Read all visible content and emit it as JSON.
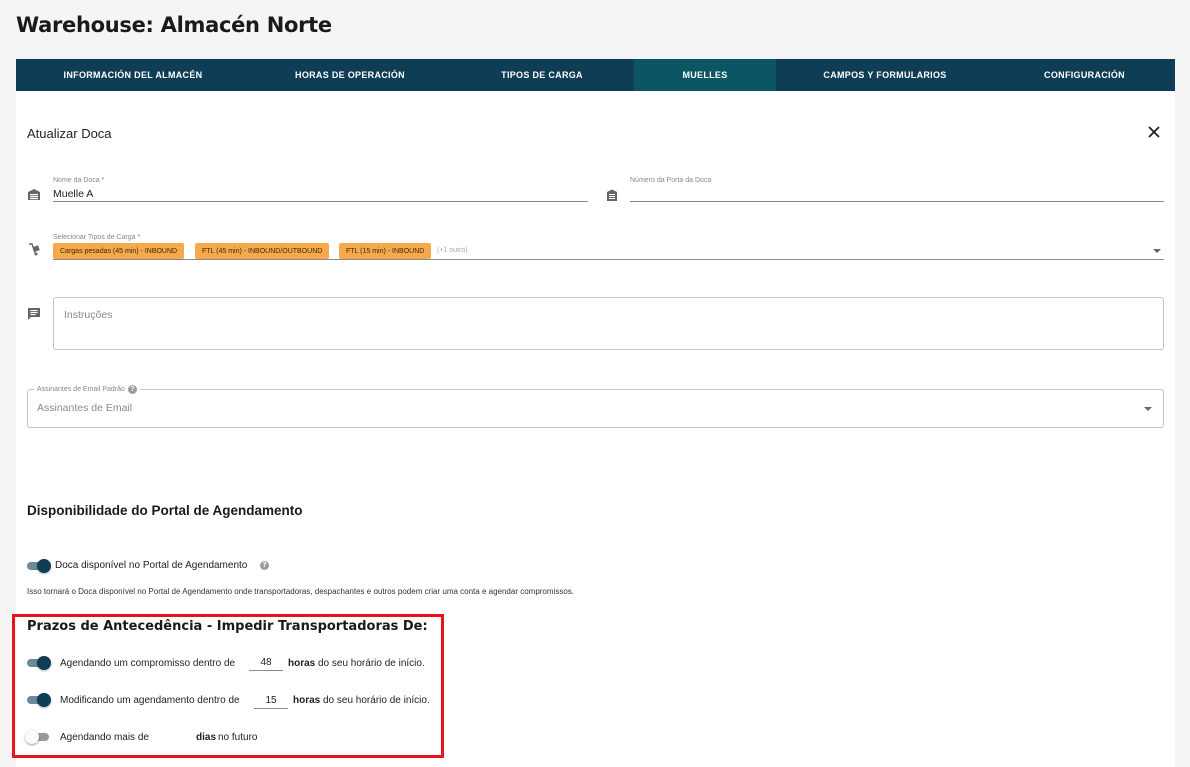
{
  "page_title": "Warehouse: Almacén Norte",
  "tabs": [
    {
      "label": "INFORMACIÓN DEL ALMACÉN",
      "active": false
    },
    {
      "label": "HORAS DE OPERACIÓN",
      "active": false
    },
    {
      "label": "TIPOS DE CARGA",
      "active": false
    },
    {
      "label": "MUELLES",
      "active": true
    },
    {
      "label": "CAMPOS Y FORMULARIOS",
      "active": false
    },
    {
      "label": "CONFIGURACIÓN",
      "active": false
    }
  ],
  "dialog": {
    "title": "Atualizar Doca",
    "close_icon": "close-icon"
  },
  "dock_name": {
    "label": "Nome da Doca *",
    "value": "Muelle A",
    "icon": "warehouse-icon"
  },
  "door_number": {
    "label": "Número da Porta da Doca",
    "value": "",
    "icon": "garage-door-icon"
  },
  "load_types": {
    "label": "Selecionar Tipos de Carga *",
    "icon": "dolly-icon",
    "chips": [
      "Cargas pesadas (45 min) - INBOUND",
      "FTL (45 min) - INBOUND/OUTBOUND",
      "FTL (15 min) - INBOUND"
    ],
    "more": "(+1 outro)"
  },
  "instructions": {
    "placeholder": "Instruções",
    "icon": "comment-icon"
  },
  "email_subscribers": {
    "legend": "Assinantes de Email Padrão",
    "placeholder": "Assinantes de Email"
  },
  "availability": {
    "title": "Disponibilidade do Portal de Agendamento",
    "toggle_label": "Doca disponível no Portal de Agendamento",
    "toggle_on": true,
    "description": "Isso tornará o Doca disponível no Portal de Agendamento onde transportadoras, despachantes e outros podem criar uma conta e agendar compromissos."
  },
  "lead_times": {
    "title": "Prazos de Antecedência - Impedir Transportadoras De:",
    "rows": [
      {
        "on": true,
        "prefix": "Agendando um compromisso dentro de",
        "value": "48",
        "unit": "horas",
        "suffix": "do seu horário de início."
      },
      {
        "on": true,
        "prefix": "Modificando um agendamento dentro de",
        "value": "15",
        "unit": "horas",
        "suffix": "do seu horário de início."
      },
      {
        "on": false,
        "prefix": "Agendando mais de",
        "value": "",
        "unit": "dias",
        "suffix": "no futuro"
      }
    ]
  },
  "colors": {
    "nav": "#0e3d55",
    "nav_active": "#0b5564",
    "chip": "#f6a94a",
    "highlight": "#e5141d"
  }
}
